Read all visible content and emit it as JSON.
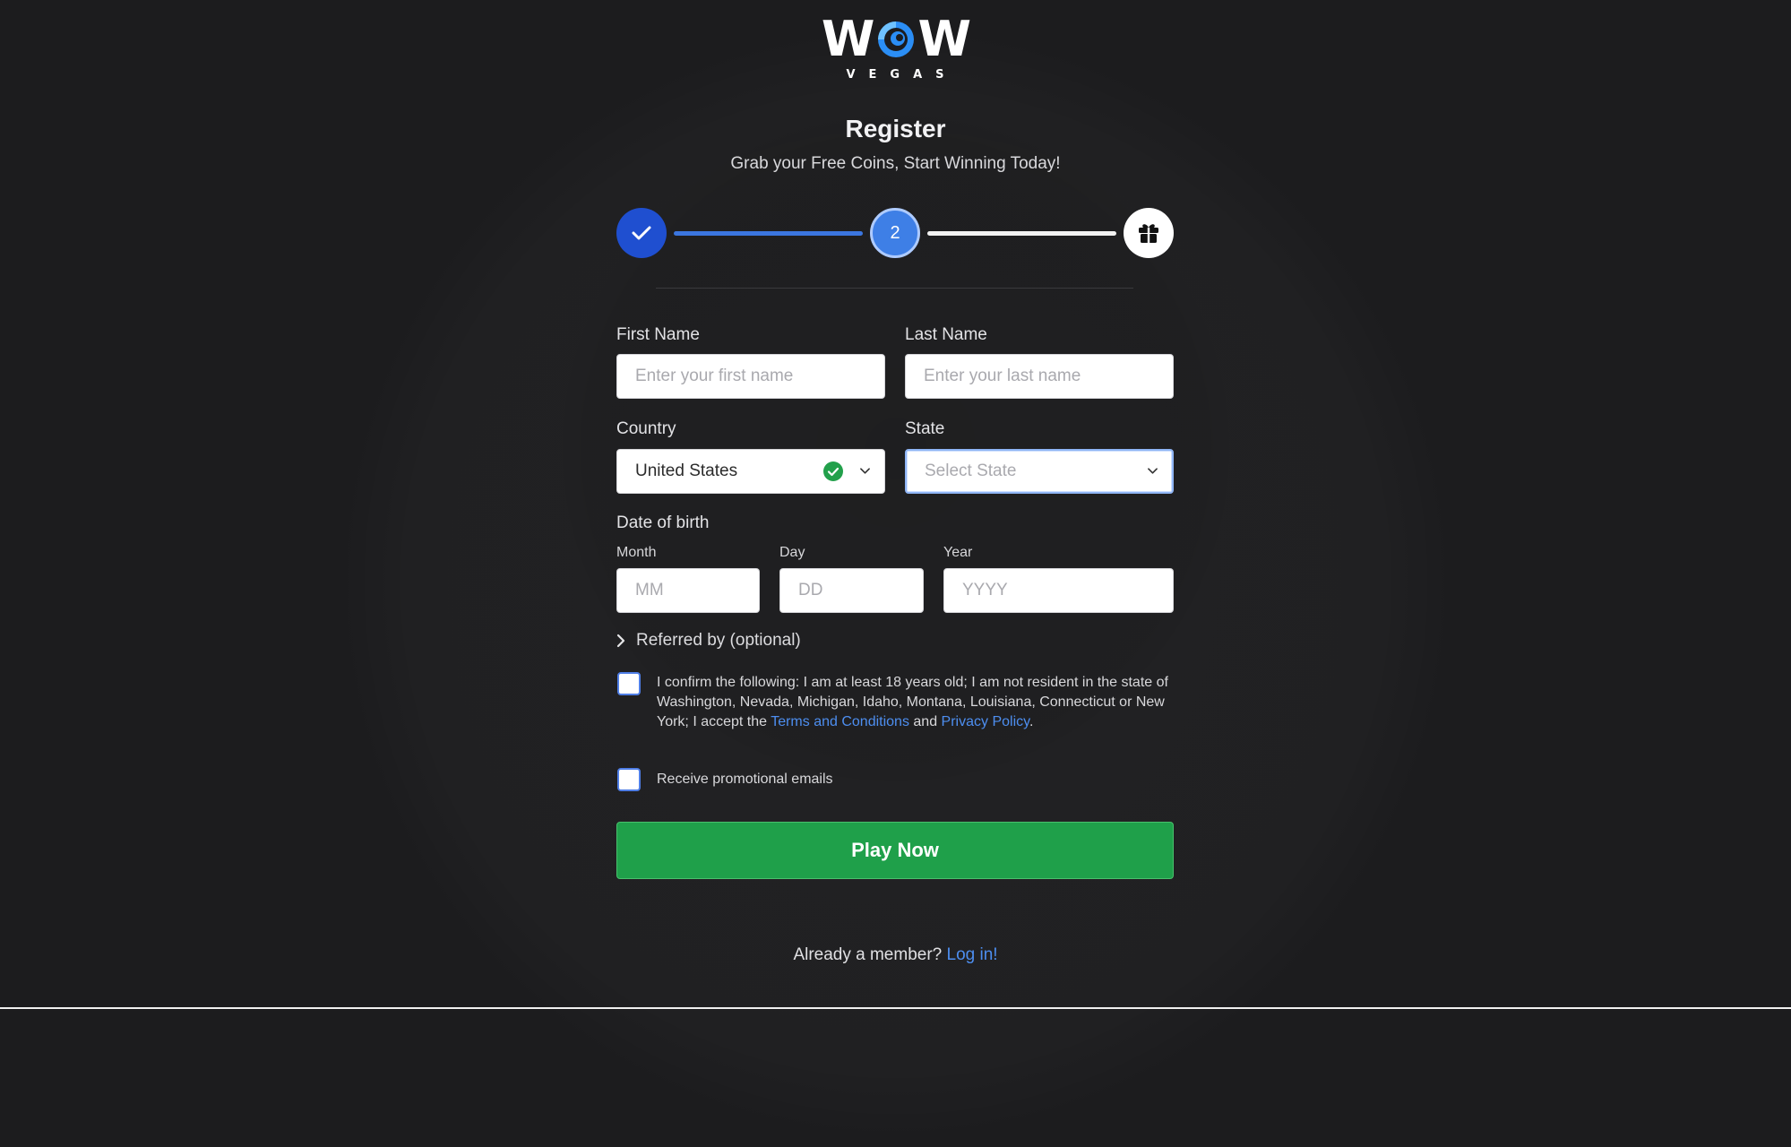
{
  "logo": {
    "wordmark_left": "W",
    "wordmark_right": "W",
    "sub": "VEGAS",
    "icon": "wow-swirl-icon"
  },
  "header": {
    "title": "Register",
    "subtitle": "Grab your Free Coins, Start Winning Today!"
  },
  "stepper": {
    "current_step": 2,
    "total_steps": 3,
    "steps": [
      {
        "state": "done",
        "icon": "check-icon"
      },
      {
        "state": "active",
        "label": "2"
      },
      {
        "state": "upcoming",
        "icon": "gift-icon"
      }
    ]
  },
  "form": {
    "first_name": {
      "label": "First Name",
      "placeholder": "Enter your first name",
      "value": ""
    },
    "last_name": {
      "label": "Last Name",
      "placeholder": "Enter your last name",
      "value": ""
    },
    "country": {
      "label": "Country",
      "value": "United States",
      "valid": true
    },
    "state": {
      "label": "State",
      "placeholder": "Select State",
      "value": ""
    },
    "dob": {
      "label": "Date of birth",
      "month": {
        "label": "Month",
        "placeholder": "MM"
      },
      "day": {
        "label": "Day",
        "placeholder": "DD"
      },
      "year": {
        "label": "Year",
        "placeholder": "YYYY"
      }
    },
    "referred": {
      "label": "Referred by (optional)"
    },
    "confirm": {
      "checked": false,
      "text_before": "I confirm the following: I am at least 18 years old; I am not resident in the state of Washington, Nevada, Michigan, Idaho, Montana, Louisiana, Connecticut or New York; I accept the ",
      "terms_link": "Terms and Conditions",
      "text_between": " and ",
      "privacy_link": "Privacy Policy",
      "text_after": "."
    },
    "promo": {
      "checked": false,
      "label": "Receive promotional emails"
    },
    "submit_label": "Play Now"
  },
  "footer": {
    "text": "Already a member? ",
    "login_link": "Log in!"
  },
  "colors": {
    "background": "#1c1c1e",
    "step_done": "#1f4fd0",
    "step_active": "#3e7fe6",
    "link": "#4d8ef0",
    "cta": "#1fa04a",
    "valid": "#22a04b"
  }
}
